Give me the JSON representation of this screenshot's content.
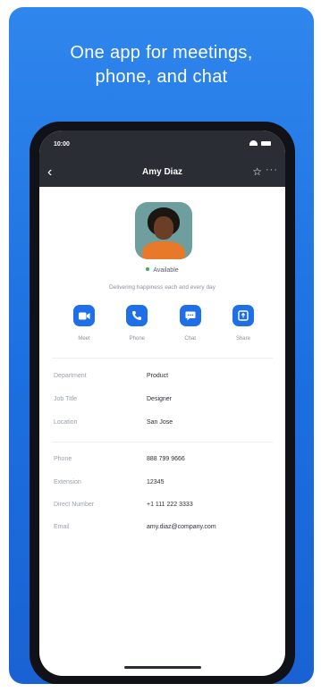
{
  "headline": {
    "line1": "One app for meetings,",
    "line2": "phone, and chat"
  },
  "phone_status": {
    "time": "10:00"
  },
  "nav": {
    "back": "‹",
    "title": "Amy Diaz",
    "star": "☆",
    "more": "···"
  },
  "profile": {
    "presence": "Available",
    "presence_color": "#2fb35a",
    "status_message": "Delivering happiness each and every day"
  },
  "actions": [
    {
      "label": "Meet",
      "icon": "video-camera-icon"
    },
    {
      "label": "Phone",
      "icon": "phone-icon"
    },
    {
      "label": "Chat",
      "icon": "chat-bubble-icon"
    },
    {
      "label": "Share",
      "icon": "share-screen-icon"
    }
  ],
  "details": [
    {
      "label": "Department",
      "value": "Product"
    },
    {
      "label": "Job Title",
      "value": "Designer"
    },
    {
      "label": "Location",
      "value": "San Jose"
    }
  ],
  "contact": [
    {
      "label": "Phone",
      "value": "888 799 9666"
    },
    {
      "label": "Extension",
      "value": "12345"
    },
    {
      "label": "Direct Number",
      "value": "+1 111 222 3333"
    },
    {
      "label": "Email",
      "value": "amy.diaz@company.com"
    }
  ],
  "colors": {
    "brand_blue": "#1e6fe8",
    "banner_blue": "#2f86ec",
    "header_dark": "#2b2d35"
  }
}
